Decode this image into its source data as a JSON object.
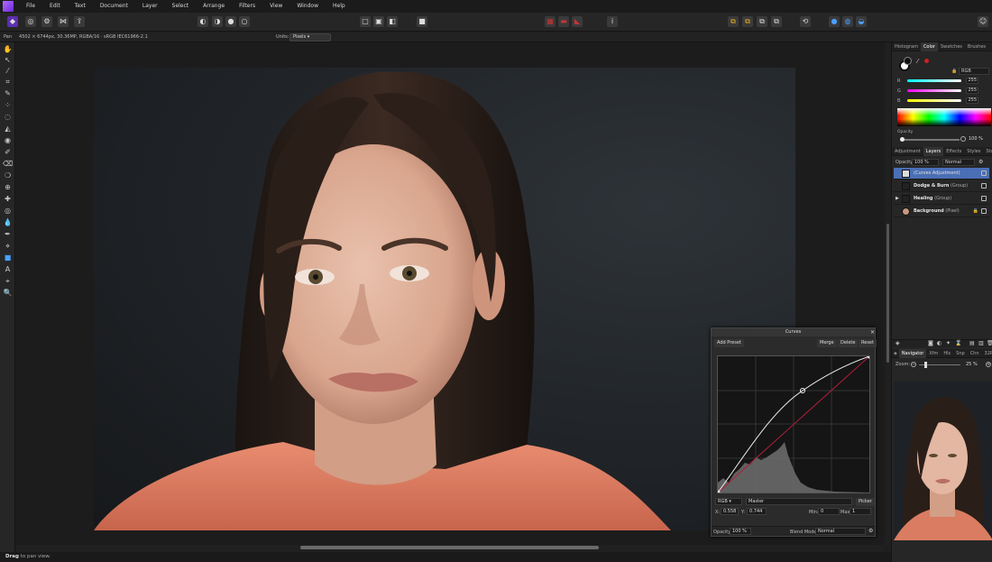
{
  "menubar": {
    "items": [
      "File",
      "Edit",
      "Text",
      "Document",
      "Layer",
      "Select",
      "Arrange",
      "Filters",
      "View",
      "Window",
      "Help"
    ]
  },
  "context": {
    "tool": "Pan",
    "doc_info": "4502 × 6744px, 30.36MP, RGBA/16 · sRGB IEC61966-2.1",
    "units_label": "Units:",
    "units_value": "Pixels"
  },
  "status": {
    "bold": "Drag",
    "rest": " to pan view."
  },
  "color_panel": {
    "tabs": [
      "Histogram",
      "Color",
      "Swatches",
      "Brushes"
    ],
    "model": "RGB",
    "channels": [
      {
        "label": "R",
        "value": "255"
      },
      {
        "label": "G",
        "value": "255"
      },
      {
        "label": "B",
        "value": "255"
      }
    ],
    "opacity_label": "Opacity",
    "opacity_value": "100 %"
  },
  "layers_panel": {
    "tabs": [
      "Adjustment",
      "Layers",
      "Effects",
      "Styles",
      "Stock"
    ],
    "opacity_label": "Opacity:",
    "opacity_value": "100 %",
    "blend": "Normal",
    "layers": [
      {
        "name": "(Curves Adjustment)",
        "type": ""
      },
      {
        "name": "Dodge & Burn",
        "type": "(Group)"
      },
      {
        "name": "Healing",
        "type": "(Group)"
      },
      {
        "name": "Background",
        "type": "(Pixel)"
      }
    ]
  },
  "navigator_panel": {
    "tabs": [
      "Navigator",
      "Xfm",
      "Hls",
      "Snp",
      "Chn",
      "32P"
    ],
    "zoom_label": "Zoom:",
    "zoom_value": "25 %"
  },
  "curves": {
    "title": "Curves",
    "add_preset": "Add Preset",
    "merge": "Merge",
    "delete": "Delete",
    "reset": "Reset",
    "channel": "RGB",
    "mode": "Master",
    "picker": "Picker",
    "x_label": "X:",
    "x_value": "0.558",
    "y_label": "Y:",
    "y_value": "0.744",
    "min_label": "Min:",
    "min_value": "0",
    "max_label": "Max:",
    "max_value": "1",
    "opacity_label": "Opacity:",
    "opacity_value": "100 %",
    "blend_label": "Blend Mode:",
    "blend_value": "Normal"
  },
  "colors": {
    "accent": "#4a6fb5",
    "curve_diag": "#b0203a"
  }
}
